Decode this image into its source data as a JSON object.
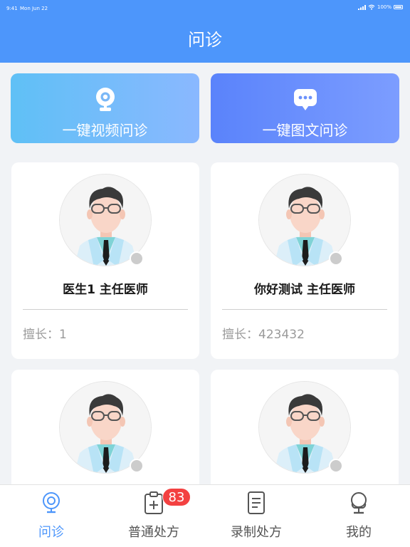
{
  "status_bar": {
    "time": "9:41",
    "date": "Mon Jun 22",
    "battery": "100%"
  },
  "header": {
    "title": "问诊"
  },
  "actions": [
    {
      "label": "一键视频问诊",
      "icon": "video-camera-icon"
    },
    {
      "label": "一键图文问诊",
      "icon": "chat-bubble-icon"
    }
  ],
  "doctors": [
    {
      "name": "医生1  主任医师",
      "specialty": "擅长：1",
      "online": false
    },
    {
      "name": "你好测试  主任医师",
      "specialty": "擅长：423432",
      "online": false
    },
    {
      "name": "",
      "specialty": "",
      "online": false
    },
    {
      "name": "",
      "specialty": "",
      "online": false
    }
  ],
  "tabbar": {
    "items": [
      {
        "label": "问诊",
        "icon": "video-camera-icon",
        "active": true
      },
      {
        "label": "普通处方",
        "icon": "clipboard-plus-icon",
        "badge": "83"
      },
      {
        "label": "录制处方",
        "icon": "document-icon"
      },
      {
        "label": "我的",
        "icon": "user-icon"
      }
    ]
  },
  "colors": {
    "primary": "#4d96fb",
    "badge": "#f34141"
  }
}
